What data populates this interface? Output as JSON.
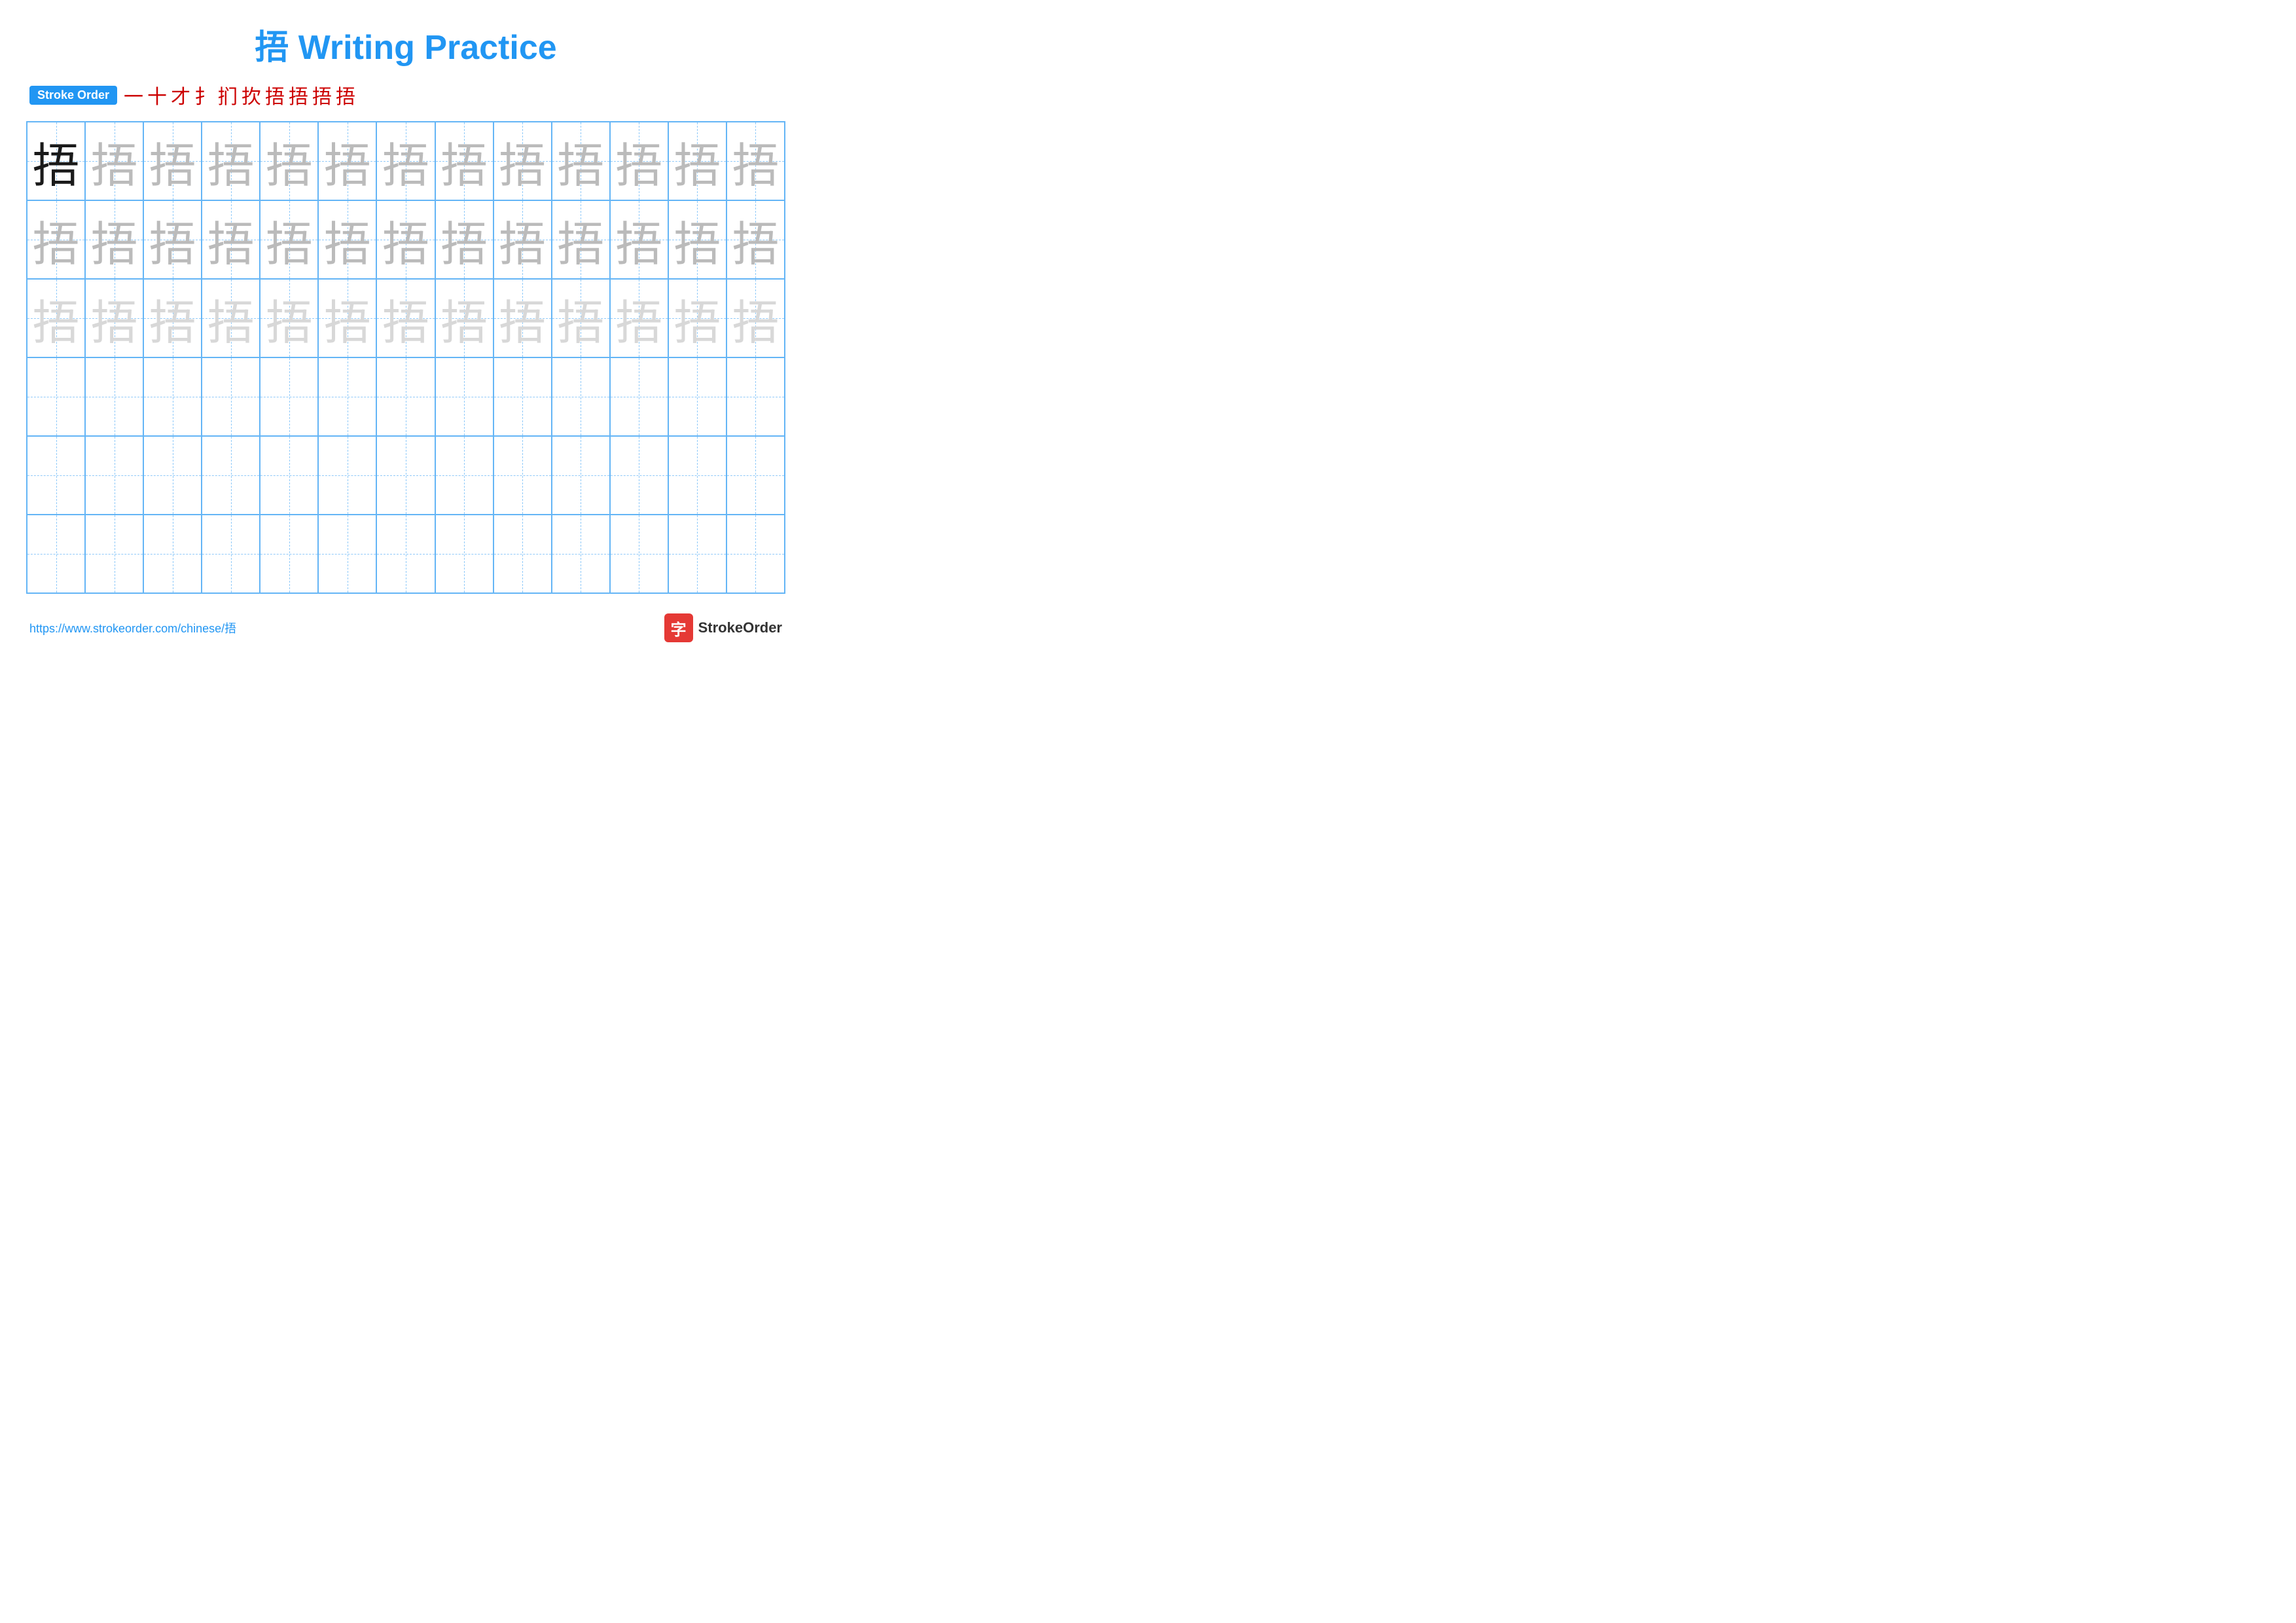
{
  "title": "捂 Writing Practice",
  "stroke_order_label": "Stroke Order",
  "stroke_sequence": [
    "一",
    "十",
    "才",
    "扌",
    "扪",
    "扻",
    "捂",
    "捂",
    "捂",
    "捂"
  ],
  "character": "捂",
  "grid": {
    "cols": 13,
    "rows": 6,
    "row_types": [
      "dark_then_medium",
      "medium",
      "light",
      "empty",
      "empty",
      "empty"
    ]
  },
  "footer": {
    "url": "https://www.strokeorder.com/chinese/捂",
    "brand_char": "字",
    "brand_name": "StrokeOrder"
  }
}
